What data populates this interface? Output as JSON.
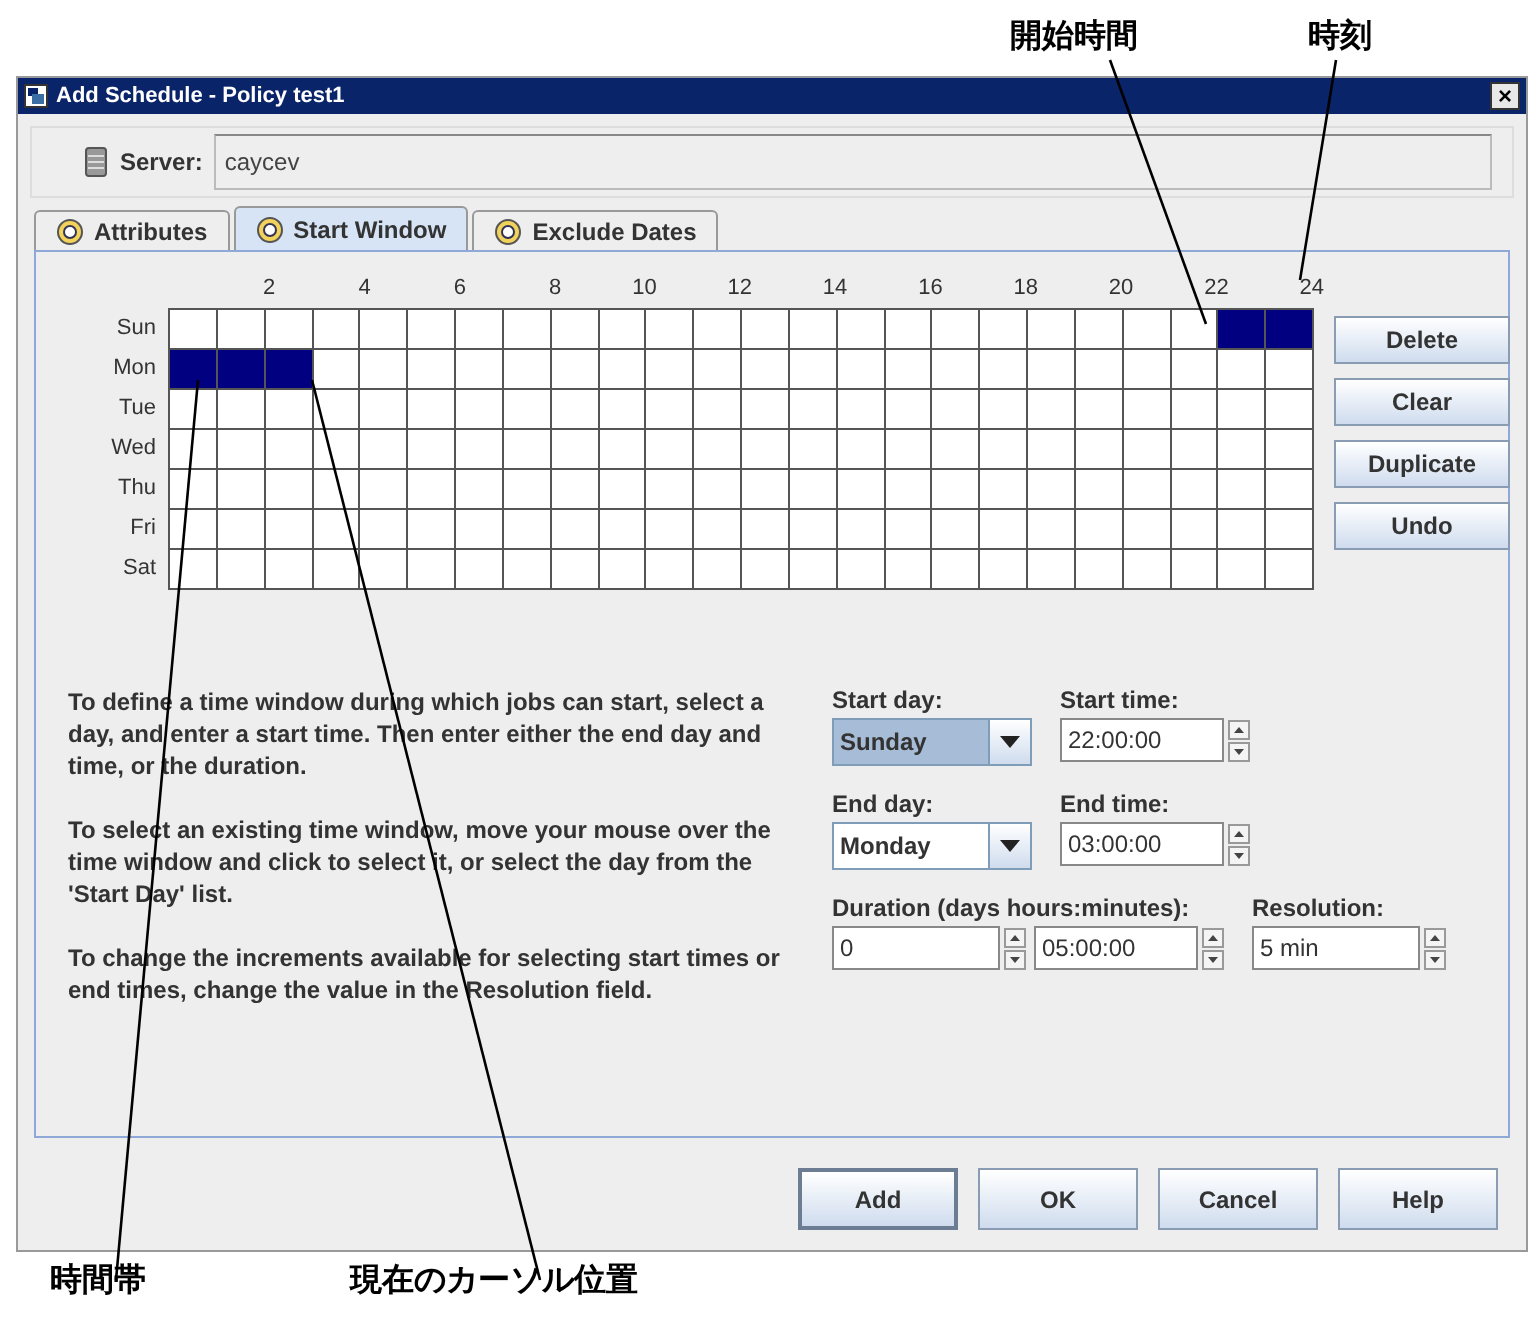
{
  "callouts": {
    "start_time": "開始時間",
    "time": "時刻",
    "time_window": "時間帯",
    "cursor": "現在のカーソル位置"
  },
  "window": {
    "title": "Add Schedule - Policy test1",
    "close": "×"
  },
  "server": {
    "label": "Server:",
    "value": "caycev"
  },
  "tabs": [
    {
      "label": "Attributes",
      "selected": false
    },
    {
      "label": "Start Window",
      "selected": true
    },
    {
      "label": "Exclude Dates",
      "selected": false
    }
  ],
  "hours": [
    "2",
    "4",
    "6",
    "8",
    "10",
    "12",
    "14",
    "16",
    "18",
    "20",
    "22",
    "24"
  ],
  "days": [
    {
      "label": "Sun",
      "filled": [
        false,
        false,
        false,
        false,
        false,
        false,
        false,
        false,
        false,
        false,
        false,
        false,
        false,
        false,
        false,
        false,
        false,
        false,
        false,
        false,
        false,
        false,
        true,
        true
      ]
    },
    {
      "label": "Mon",
      "filled": [
        true,
        true,
        true,
        false,
        false,
        false,
        false,
        false,
        false,
        false,
        false,
        false,
        false,
        false,
        false,
        false,
        false,
        false,
        false,
        false,
        false,
        false,
        false,
        false
      ]
    },
    {
      "label": "Tue",
      "filled": [
        false,
        false,
        false,
        false,
        false,
        false,
        false,
        false,
        false,
        false,
        false,
        false,
        false,
        false,
        false,
        false,
        false,
        false,
        false,
        false,
        false,
        false,
        false,
        false
      ]
    },
    {
      "label": "Wed",
      "filled": [
        false,
        false,
        false,
        false,
        false,
        false,
        false,
        false,
        false,
        false,
        false,
        false,
        false,
        false,
        false,
        false,
        false,
        false,
        false,
        false,
        false,
        false,
        false,
        false
      ]
    },
    {
      "label": "Thu",
      "filled": [
        false,
        false,
        false,
        false,
        false,
        false,
        false,
        false,
        false,
        false,
        false,
        false,
        false,
        false,
        false,
        false,
        false,
        false,
        false,
        false,
        false,
        false,
        false,
        false
      ]
    },
    {
      "label": "Fri",
      "filled": [
        false,
        false,
        false,
        false,
        false,
        false,
        false,
        false,
        false,
        false,
        false,
        false,
        false,
        false,
        false,
        false,
        false,
        false,
        false,
        false,
        false,
        false,
        false,
        false
      ]
    },
    {
      "label": "Sat",
      "filled": [
        false,
        false,
        false,
        false,
        false,
        false,
        false,
        false,
        false,
        false,
        false,
        false,
        false,
        false,
        false,
        false,
        false,
        false,
        false,
        false,
        false,
        false,
        false,
        false
      ]
    }
  ],
  "side_buttons": [
    {
      "label": "Delete"
    },
    {
      "label": "Clear"
    },
    {
      "label": "Duplicate"
    },
    {
      "label": "Undo"
    }
  ],
  "help": [
    "To define a time window during which jobs can start, select a day, and enter a start time. Then enter either the end day and time, or the duration.",
    "To select an existing time window, move your mouse over the time window and click to select it, or select the day from the 'Start Day' list.",
    "To change the increments available for selecting start times or end times, change the value in the Resolution field."
  ],
  "start_day": {
    "label": "Start day:",
    "value": "Sunday",
    "focused": true
  },
  "start_time": {
    "label": "Start time:",
    "value": "22:00:00"
  },
  "end_day": {
    "label": "End day:",
    "value": "Monday",
    "focused": false
  },
  "end_time": {
    "label": "End time:",
    "value": "03:00:00"
  },
  "duration": {
    "label": "Duration (days hours:minutes):",
    "days": "0",
    "time": "05:00:00"
  },
  "resolution": {
    "label": "Resolution:",
    "value": "5 min"
  },
  "buttons": [
    {
      "label": "Add",
      "default": true
    },
    {
      "label": "OK",
      "default": false
    },
    {
      "label": "Cancel",
      "default": false
    },
    {
      "label": "Help",
      "default": false
    }
  ]
}
